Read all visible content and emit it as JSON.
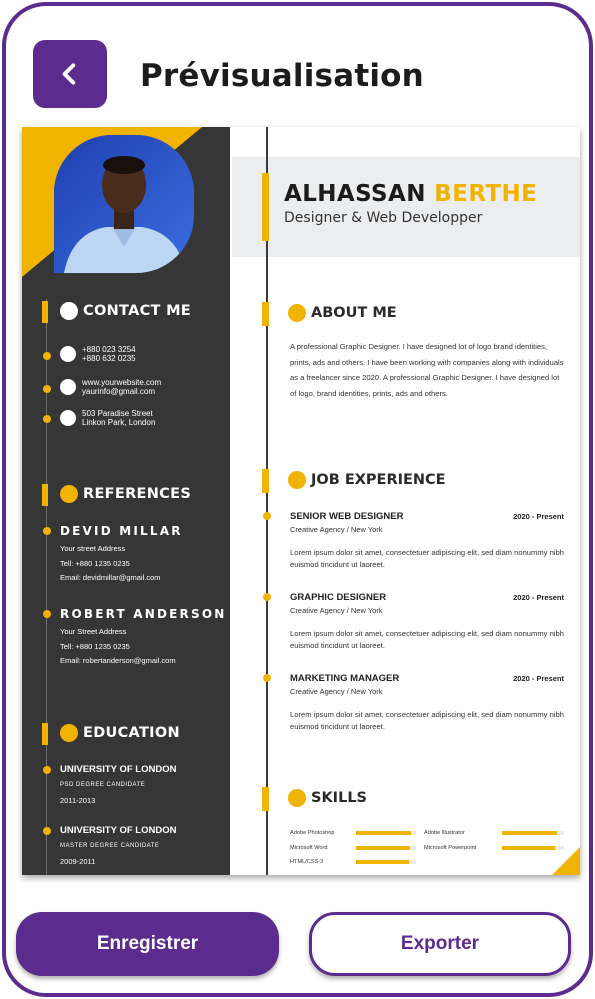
{
  "header": {
    "title": "Prévisualisation",
    "back_icon": "chevron-left-icon"
  },
  "resume": {
    "first_name": "ALHASSAN",
    "last_name": "BERTHE",
    "role": "Designer & Web Developper",
    "contact": {
      "heading": "CONTACT ME",
      "phone1": "+880 023 3254",
      "phone2": "+880 632 0235",
      "website": "www.yourwebsite.com",
      "email": "yaurinfo@gmail.com",
      "address1": "503 Paradise Street",
      "address2": "Linkon Park, London"
    },
    "references": {
      "heading": "REFERENCES",
      "items": [
        {
          "name": "DEVID MILLAR",
          "address": "Your street Address",
          "tel": "Tell: +880 1235 0235",
          "email": "Email: devidmillar@gmail.com"
        },
        {
          "name": "ROBERT ANDERSON",
          "address": "Your Street Address",
          "tel": "Tell: +880 1235 0235",
          "email": "Email: robertanderson@gmail.com"
        }
      ]
    },
    "education": {
      "heading": "EDUCATION",
      "items": [
        {
          "school": "UNIVERSITY OF LONDON",
          "degree": "PSD DEGREE CANDIDATE",
          "years": "2011-2013"
        },
        {
          "school": "UNIVERSITY OF LONDON",
          "degree": "MASTER DEGREE CANDIDATE",
          "years": "2009-2011"
        }
      ]
    },
    "about": {
      "heading": "ABOUT ME",
      "text": "A professional Graphic Designer. I have designed lot of logo brand identities, prints, ads and others. I have been working with companies along with individuals as a freelancer since 2020. A professional Graphic Designer. I have designed lot of logo, brand identities, prints, ads and others."
    },
    "experience": {
      "heading": "JOB EXPERIENCE",
      "items": [
        {
          "title": "SENIOR WEB DESIGNER",
          "date": "2020 - Present",
          "company": "Creative Agency / New York",
          "desc": "Lorem ipsum dolor sit amet, consectetuer adipiscing elit, sed diam nonummy nibh euismod tincidunt ut laoreet."
        },
        {
          "title": "GRAPHIC DESIGNER",
          "date": "2020 - Present",
          "company": "Creative Agency / New York",
          "desc": "Lorem ipsum dolor sit amet, consectetuer adipiscing elit, sed diam nonummy nibh euismod tincidunt ut laoreet."
        },
        {
          "title": "MARKETING MANAGER",
          "date": "2020 - Present",
          "company": "Creative Agency / New York",
          "desc": "Lorem ipsum dolor sit amet, consectetuer adipiscing elit, sed diam nonummy nibh euismod tincidunt ut laoreet."
        }
      ]
    },
    "skills": {
      "heading": "SKILLS",
      "items": [
        {
          "name": "Adobe Photoshop",
          "level": 0.92
        },
        {
          "name": "Adobe Illustrator",
          "level": 0.88
        },
        {
          "name": "Microsoft Word",
          "level": 0.9
        },
        {
          "name": "Microsoft Powerpoint",
          "level": 0.85
        },
        {
          "name": "HTML/CSS-3",
          "level": 0.88
        }
      ]
    }
  },
  "actions": {
    "save_label": "Enregistrer",
    "export_label": "Exporter"
  },
  "colors": {
    "brand": "#5b2c8e",
    "accent": "#f0b400",
    "sidebar": "#363636"
  }
}
